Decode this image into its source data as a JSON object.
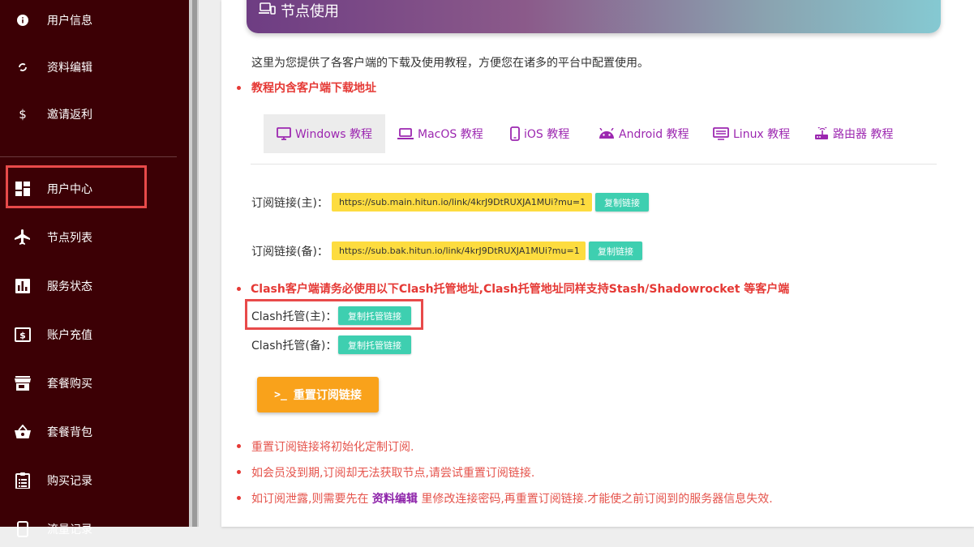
{
  "sidebar": {
    "items": [
      {
        "label": "用户信息",
        "icon": "info-icon"
      },
      {
        "label": "资料编辑",
        "icon": "sync-icon"
      },
      {
        "label": "邀请返利",
        "icon": "dollar-icon"
      },
      {
        "label": "用户中心",
        "icon": "dashboard-icon"
      },
      {
        "label": "节点列表",
        "icon": "airplane-icon"
      },
      {
        "label": "服务状态",
        "icon": "bar-chart-icon"
      },
      {
        "label": "账户充值",
        "icon": "money-icon"
      },
      {
        "label": "套餐购买",
        "icon": "store-icon"
      },
      {
        "label": "套餐背包",
        "icon": "basket-icon"
      },
      {
        "label": "购买记录",
        "icon": "clipboard-icon"
      },
      {
        "label": "流量记录",
        "icon": "phone-icon"
      }
    ]
  },
  "card": {
    "title": "节点使用",
    "intro": "这里为您提供了各客户端的下载及使用教程，方便您在诸多的平台中配置使用。",
    "tutorial_note": "教程内含客户端下载地址"
  },
  "tabs": [
    {
      "label": "Windows 教程",
      "icon": "monitor-icon"
    },
    {
      "label": "MacOS 教程",
      "icon": "laptop-icon"
    },
    {
      "label": "iOS 教程",
      "icon": "phone-icon"
    },
    {
      "label": "Android 教程",
      "icon": "android-icon"
    },
    {
      "label": "Linux 教程",
      "icon": "terminal-icon"
    },
    {
      "label": "路由器 教程",
      "icon": "router-icon"
    }
  ],
  "subscription": {
    "main_label": "订阅链接(主)：",
    "main_url": "https://sub.main.hitun.io/link/4krJ9DtRUXJA1MUi?mu=1",
    "bak_label": "订阅链接(备)：",
    "bak_url": "https://sub.bak.hitun.io/link/4krJ9DtRUXJA1MUi?mu=1",
    "copy_label": "复制链接"
  },
  "clash": {
    "note": "Clash客户端请务必使用以下Clash托管地址,Clash托管地址同样支持Stash/Shadowrocket 等客户端",
    "main_label": "Clash托管(主)：",
    "bak_label": "Clash托管(备)：",
    "copy_label": "复制托管链接"
  },
  "reset": {
    "prompt": ">_",
    "label": "重置订阅链接"
  },
  "notes": {
    "n1": "重置订阅链接将初始化定制订阅.",
    "n2": "如会员没到期,订阅却无法获取节点,请尝试重置订阅链接.",
    "n3_pre": "如订阅泄露,则需要先在 ",
    "n3_link": "资料编辑",
    "n3_post": " 里修改连接密码,再重置订阅链接.才能使之前订阅到的服务器信息失效."
  }
}
